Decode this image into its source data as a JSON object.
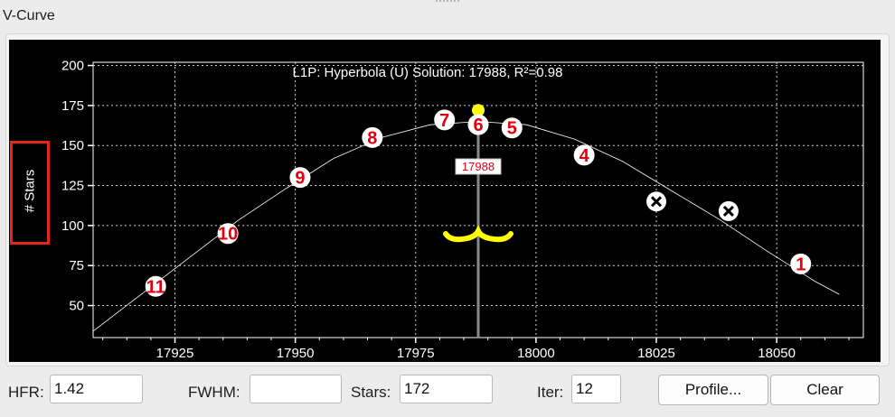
{
  "group_title": "V-Curve",
  "chart_data": {
    "type": "scatter",
    "title": "L1P: Hyperbola (U) Solution: 17988, R²=0.98",
    "ylabel": "# Stars",
    "xlabel": "",
    "xlim": [
      17908,
      18068
    ],
    "ylim": [
      30,
      202
    ],
    "x_ticks": [
      17925,
      17950,
      17975,
      18000,
      18025,
      18050
    ],
    "y_ticks": [
      50,
      75,
      100,
      125,
      150,
      175,
      200
    ],
    "grid": true,
    "points": [
      {
        "label": "1",
        "x": 18055,
        "y": 76,
        "state": "accepted"
      },
      {
        "label": "",
        "x": 18040,
        "y": 109,
        "state": "rejected"
      },
      {
        "label": "",
        "x": 18025,
        "y": 115,
        "state": "rejected"
      },
      {
        "label": "4",
        "x": 18010,
        "y": 144,
        "state": "accepted"
      },
      {
        "label": "5",
        "x": 17995,
        "y": 161,
        "state": "accepted"
      },
      {
        "label": "6",
        "x": 17988,
        "y": 163,
        "state": "accepted"
      },
      {
        "label": "7",
        "x": 17981,
        "y": 166,
        "state": "accepted"
      },
      {
        "label": "8",
        "x": 17966,
        "y": 155,
        "state": "accepted"
      },
      {
        "label": "9",
        "x": 17951,
        "y": 130,
        "state": "accepted"
      },
      {
        "label": "10",
        "x": 17936,
        "y": 95,
        "state": "accepted"
      },
      {
        "label": "11",
        "x": 17921,
        "y": 62,
        "state": "accepted"
      }
    ],
    "fit_curve": {
      "x": [
        17908,
        17918,
        17928,
        17938,
        17948,
        17958,
        17968,
        17978,
        17988,
        17998,
        18008,
        18018,
        18028,
        18038,
        18048,
        18058,
        18063
      ],
      "y": [
        34,
        57,
        80,
        103,
        123,
        142,
        155,
        163,
        165,
        163,
        154,
        140,
        122,
        104,
        84,
        65,
        57
      ]
    },
    "solution": {
      "x": 17988,
      "y": 172,
      "label": "17988"
    },
    "colors": {
      "background": "#000000",
      "grid": "#d0d0d0",
      "axis": "#ffffff",
      "point": "#e00010",
      "solution": "#ffff00",
      "curve": "#ffffff"
    }
  },
  "hfr": {
    "label": "HFR:",
    "value": "1.42"
  },
  "fwhm": {
    "label": "FWHM:",
    "value": ""
  },
  "stars": {
    "label": "Stars:",
    "value": "172"
  },
  "iter": {
    "label": "Iter:",
    "value": "12"
  },
  "profile_button": "Profile...",
  "clear_button": "Clear"
}
